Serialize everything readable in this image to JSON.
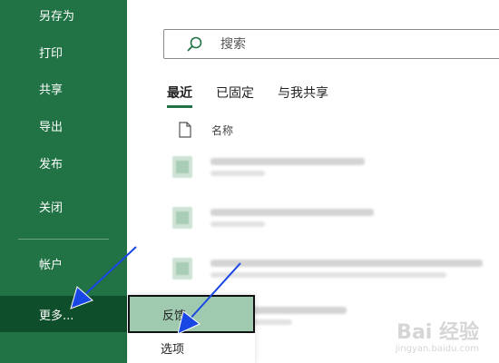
{
  "sidebar": {
    "items": [
      {
        "label": "另存为"
      },
      {
        "label": "打印"
      },
      {
        "label": "共享"
      },
      {
        "label": "导出"
      },
      {
        "label": "发布"
      },
      {
        "label": "关闭"
      },
      {
        "label": "帐户"
      },
      {
        "label": "更多..."
      }
    ],
    "active_index": 7
  },
  "search": {
    "placeholder": "搜索"
  },
  "tabs": [
    {
      "label": "最近",
      "active": true
    },
    {
      "label": "已固定",
      "active": false
    },
    {
      "label": "与我共享",
      "active": false
    }
  ],
  "list": {
    "column_name": "名称"
  },
  "submenu": {
    "items": [
      {
        "label": "反馈",
        "highlighted": true
      },
      {
        "label": "选项",
        "highlighted": false
      }
    ]
  },
  "watermark": {
    "text": "Bai 经验",
    "sub": "jingyan.baidu.com"
  },
  "colors": {
    "sidebar_bg": "#217346",
    "sidebar_active": "#0e4e2a",
    "submenu_highlight": "#9fcab0",
    "arrow": "#1947e5"
  }
}
